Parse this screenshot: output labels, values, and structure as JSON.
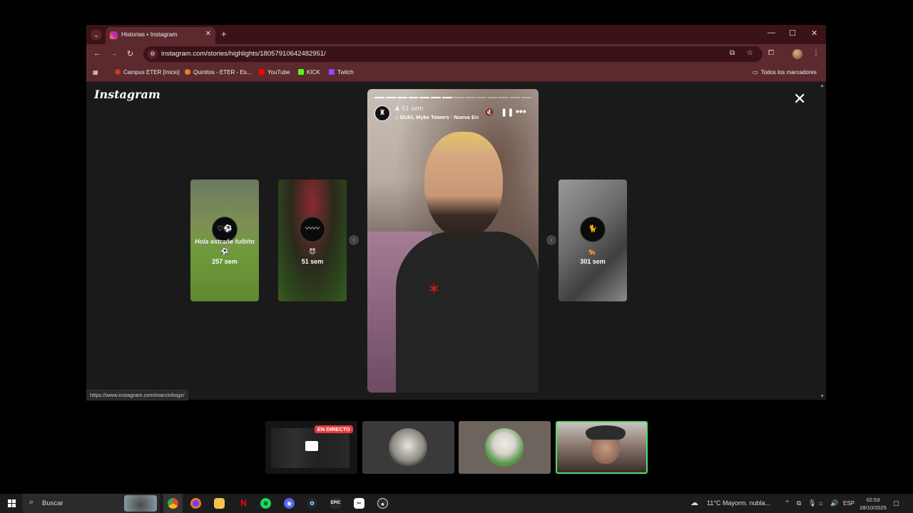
{
  "browser": {
    "tab_title": "Historias • Instagram",
    "url": "instagram.com/stories/highlights/18057910642482951/",
    "bookmarks": [
      {
        "label": "Campus ETER [Inicio]",
        "color": "#c0392b"
      },
      {
        "label": "Quinttos - ETER - Es...",
        "color": "#e67e22"
      },
      {
        "label": "YouTube",
        "color": "#ff0000"
      },
      {
        "label": "KICK",
        "color": "#53fc18"
      },
      {
        "label": "Twitch",
        "color": "#9146ff"
      }
    ],
    "all_bookmarks_label": "Todos los marcadores",
    "status_url": "https://www.instagram.com/marcinhogz/"
  },
  "instagram": {
    "logo_text": "Instagram",
    "main_story": {
      "time": "51 sem",
      "music": "DUKI, Myke Towers · Nueva Era",
      "progress_total": 14,
      "progress_done": 7
    },
    "side_stories": [
      {
        "subtitle": "Hola extrañe fulbito",
        "emoji": "⚽",
        "time": "257 sem",
        "avatar_glyph": "♡⚽"
      },
      {
        "subtitle": "",
        "emoji": "😈",
        "time": "51 sem",
        "avatar_glyph": "〰〰"
      },
      {
        "subtitle": "",
        "emoji": "🐆",
        "time": "301 sem",
        "avatar_glyph": "🐈"
      }
    ]
  },
  "thumbnails": {
    "live_badge": "EN DIRECTO"
  },
  "taskbar": {
    "search_placeholder": "Buscar",
    "weather": "11°C  Mayorm. nubla...",
    "language": "ESP",
    "time": "02:53",
    "date": "28/10/2025"
  }
}
